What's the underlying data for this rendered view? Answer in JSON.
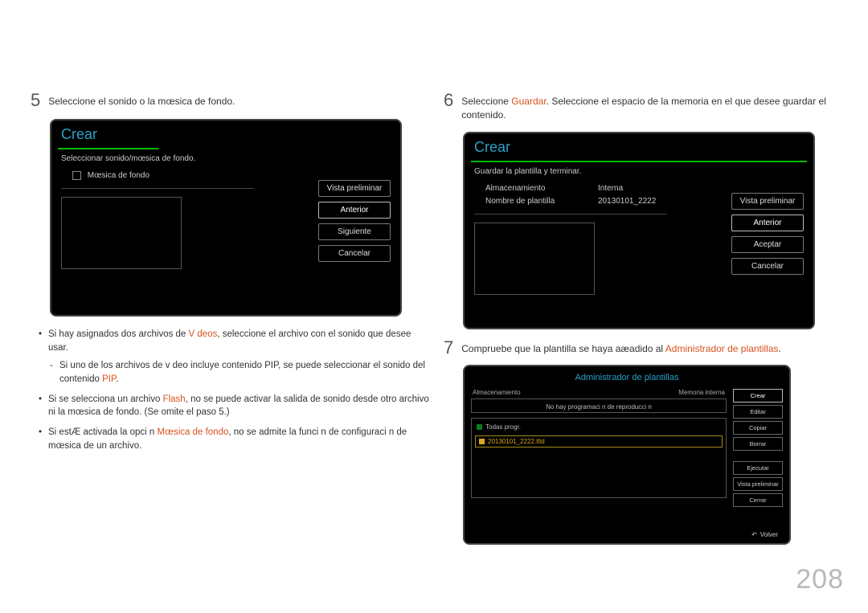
{
  "page_number": "208",
  "step5": {
    "num": "5",
    "text": "Seleccione el sonido o la mœsica de fondo."
  },
  "panel5": {
    "title": "Crear",
    "subtitle": "Seleccionar sonido/mœsica de fondo.",
    "checkbox_label": "Mœsica de fondo",
    "buttons": {
      "preview": "Vista preliminar",
      "prev": "Anterior",
      "next": "Siguiente",
      "cancel": "Cancelar"
    }
  },
  "bullets": {
    "b1_a": "Si hay asignados dos archivos de ",
    "b1_hl": "V deos",
    "b1_b": ", seleccione el archivo con el sonido que desee usar.",
    "b1_sub_a": "Si uno de los archivos de v deo incluye contenido PIP, se puede seleccionar el sonido del contenido ",
    "b1_sub_hl": "PIP",
    "b1_sub_b": ".",
    "b2_a": "Si se selecciona un archivo ",
    "b2_hl": "Flash",
    "b2_b": ", no se puede activar la salida de sonido desde otro archivo ni la mœsica de fondo. (Se omite el paso 5.)",
    "b3_a": "Si estÆ activada la opci n ",
    "b3_hl": "Mœsica de fondo",
    "b3_b": ", no se admite la funci n de configuraci n de mœsica de un archivo."
  },
  "step6": {
    "num": "6",
    "text_a": "Seleccione ",
    "text_hl": "Guardar",
    "text_b": ". Seleccione el espacio de la memoria en el que desee guardar el contenido."
  },
  "panel6": {
    "title": "Crear",
    "subtitle": "Guardar la plantilla y terminar.",
    "row1_k": "Almacenamiento",
    "row1_v": "Interna",
    "row2_k": "Nombre de plantilla",
    "row2_v": "20130101_2222",
    "buttons": {
      "preview": "Vista preliminar",
      "prev": "Anterior",
      "accept": "Aceptar",
      "cancel": "Cancelar"
    }
  },
  "step7": {
    "num": "7",
    "text_a": "Compruebe que la plantilla se haya aæadido al ",
    "text_hl": "Administrador de plantillas",
    "text_b": "."
  },
  "admin": {
    "title": "Administrador de plantillas",
    "storage_label": "Almacenamiento",
    "storage_value": "Memoria interna",
    "msg": "No hay programaci n de reproducci n",
    "item_all": "Todas progr.",
    "item_file": "20130101_2222.tltd",
    "buttons": {
      "create": "Crear",
      "edit": "Editar",
      "copy": "Copiar",
      "delete": "Borrar",
      "run": "Ejecutar",
      "preview": "Vista preliminar",
      "close": "Cerrar"
    },
    "return": "Volver"
  }
}
